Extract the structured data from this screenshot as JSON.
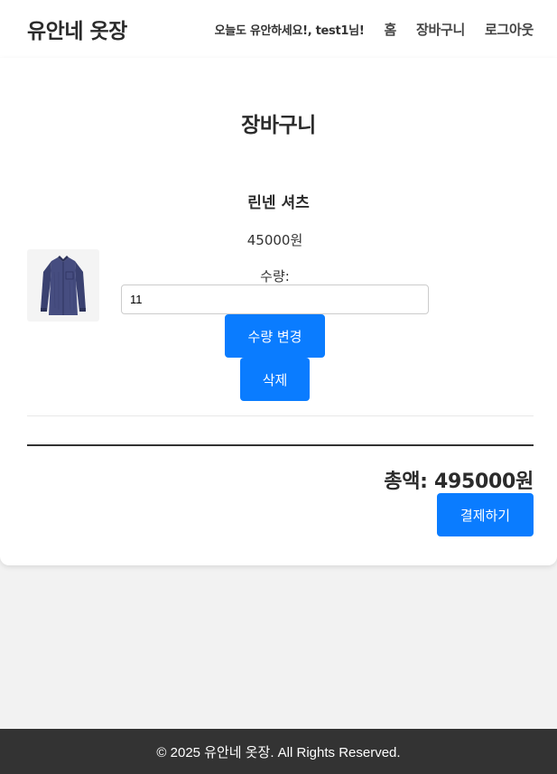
{
  "header": {
    "logo": "유안네 옷장",
    "greeting": "오늘도 유안하세요!, test1님!",
    "nav": {
      "home": "홈",
      "cart": "장바구니",
      "logout": "로그아웃"
    }
  },
  "cart": {
    "title": "장바구니",
    "items": [
      {
        "name": "린넨 셔츠",
        "price": "45000원",
        "quantity_label": "수량:",
        "quantity": "11",
        "update_button": "수량 변경",
        "delete_button": "삭제",
        "image_icon": "shirt-image"
      }
    ],
    "total_label": "총액:",
    "total_value": "495000원",
    "checkout_button": "결제하기"
  },
  "footer": {
    "text": "© 2025 유안네 옷장. All Rights Reserved."
  },
  "colors": {
    "accent": "#0a7cff",
    "footer_bg": "#333333",
    "page_bg": "#f2f2f2"
  }
}
